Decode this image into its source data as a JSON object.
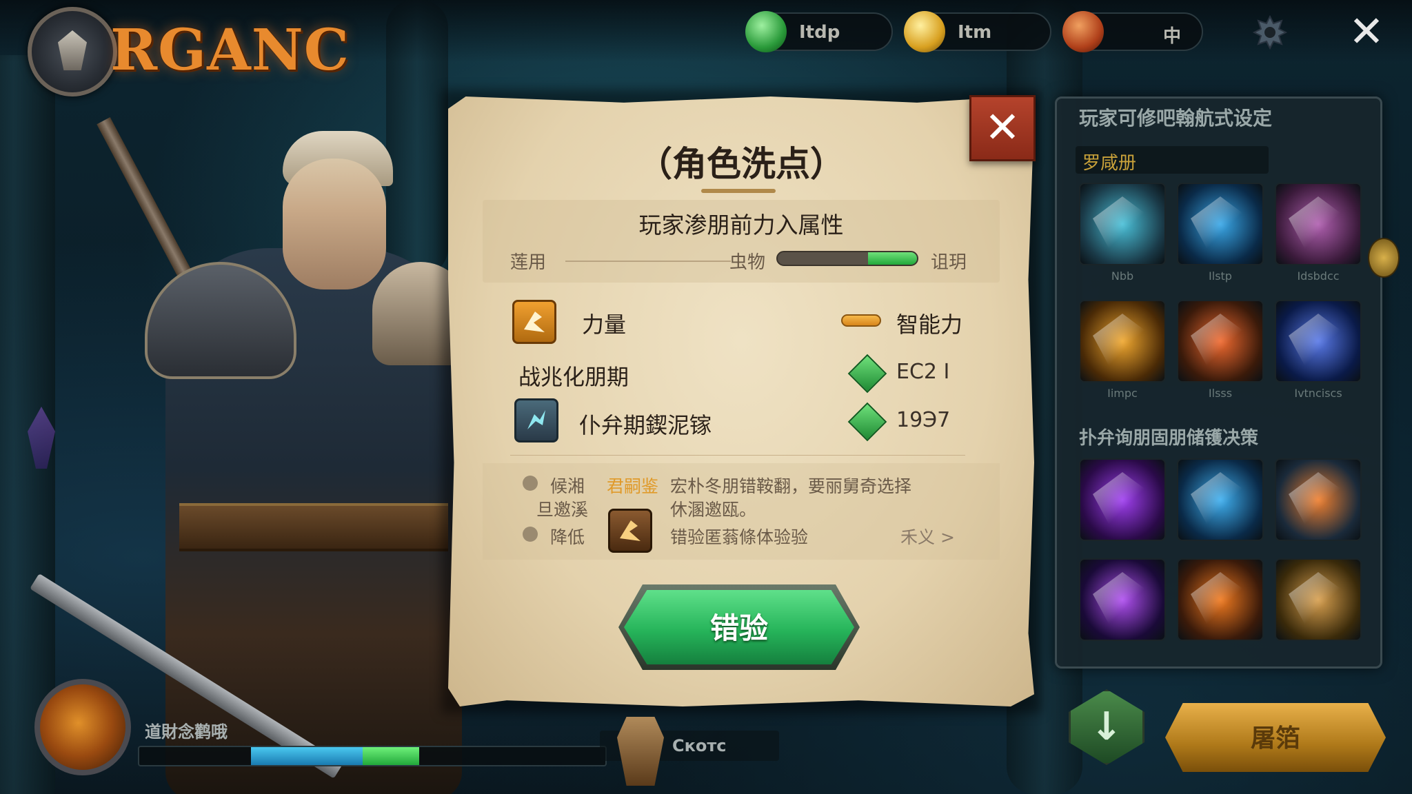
{
  "header": {
    "logo_text": "RGANC",
    "resources": [
      {
        "label": "Itdp",
        "icon": "gem-green-icon"
      },
      {
        "label": "Itm",
        "icon": "gold-coin-icon"
      },
      {
        "label": "中",
        "icon": "red-orb-icon"
      }
    ],
    "settings_icon": "gear-icon",
    "close_glyph": "✕"
  },
  "modal": {
    "title": "（角色洗点）",
    "close_glyph": "✕",
    "section_title": "玩家渗朋前力入属性",
    "slider": {
      "left_label": "莲用",
      "mid_label": "虫物",
      "right_label": "诅玥",
      "fill_fraction": 0.35
    },
    "attributes": [
      {
        "icon": "strength-icon",
        "label": "力量",
        "right_label": "智能力"
      },
      {
        "label": "战兆化朋期",
        "value": "ЕС2 I"
      },
      {
        "icon": "agility-icon",
        "label": "仆弁期鍥泥镓",
        "value": "19Э7"
      }
    ],
    "notes": [
      {
        "label": "候湘",
        "highlight": "君嗣鉴",
        "text": "宏朴冬朋错鞍翻，要丽舅奇选择"
      },
      {
        "label": "旦邀溪",
        "text": "休溷邀瓯。"
      },
      {
        "label": "降低",
        "text": "错验匿蓊條体验验",
        "link": "禾义 >"
      }
    ],
    "confirm_label": "错验"
  },
  "right_panel": {
    "title": "玩家可修吧翰航式设定",
    "subtitle": "罗咸册",
    "section_title": "扑弁询朋固朋储镬决策",
    "skills": [
      {
        "caption": "Nbb",
        "color": "#4ac0d8",
        "accent": "#1a3a48"
      },
      {
        "caption": "Ilstp",
        "color": "#3aa8e8",
        "accent": "#0a2a48"
      },
      {
        "caption": "Idsbdcc",
        "color": "#b060b0",
        "accent": "#3a1a3a"
      },
      {
        "caption": "Iimpc",
        "color": "#f0a830",
        "accent": "#4a2a06"
      },
      {
        "caption": "Ilsss",
        "color": "#f06a30",
        "accent": "#3a1a0a"
      },
      {
        "caption": "Ivtnciscs",
        "color": "#5a7ae8",
        "accent": "#0a1a48"
      },
      {
        "caption": "",
        "color": "#a040f0",
        "accent": "#2a0a48"
      },
      {
        "caption": "",
        "color": "#40b0f0",
        "accent": "#0a2a48"
      },
      {
        "caption": "",
        "color": "#f08030",
        "accent": "#1a2a3a"
      },
      {
        "caption": "",
        "color": "#b050f0",
        "accent": "#1a0a38"
      },
      {
        "caption": "",
        "color": "#f07a20",
        "accent": "#3a1a0a"
      },
      {
        "caption": "",
        "color": "#d8a050",
        "accent": "#3a2a0a"
      }
    ]
  },
  "footer": {
    "player_label": "道財念鹳哦",
    "xp_blue_fraction": 0.24,
    "xp_green_fraction": 0.12,
    "companion_label": "Скотс",
    "download_glyph": "↓",
    "gold_button_label": "屠箔"
  },
  "colors": {
    "accent_green": "#26b45a",
    "accent_gold": "#e8b04a",
    "close_red": "#b5432c",
    "parchment": "#e4d2ad"
  }
}
